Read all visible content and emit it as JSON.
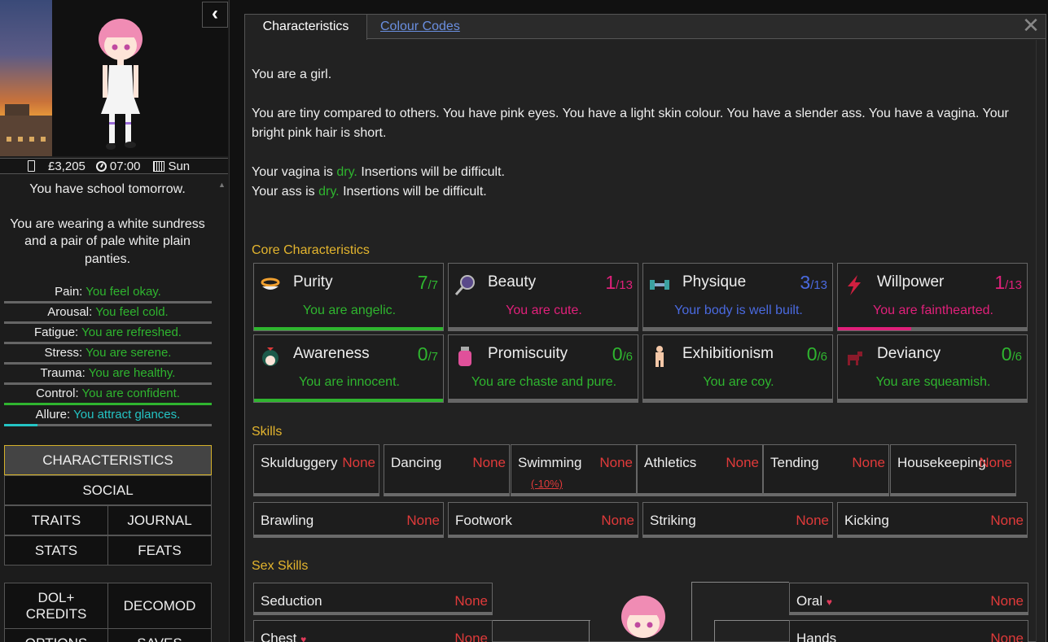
{
  "sidebar": {
    "status": {
      "money": "£3,205",
      "time": "07:00",
      "day": "Sun"
    },
    "school_notice": "You have school tomorrow.",
    "clothing": "You are wearing a white sundress and a pair of pale white plain panties.",
    "stats": [
      {
        "label": "Pain:",
        "value": "You feel okay.",
        "color": "#2fb52f",
        "level": 0
      },
      {
        "label": "Arousal:",
        "value": "You feel cold.",
        "color": "#2fb52f",
        "level": 0
      },
      {
        "label": "Fatigue:",
        "value": "You are refreshed.",
        "color": "#2fb52f",
        "level": 0
      },
      {
        "label": "Stress:",
        "value": "You are serene.",
        "color": "#2fb52f",
        "level": 0
      },
      {
        "label": "Trauma:",
        "value": "You are healthy.",
        "color": "#2fb52f",
        "level": 0
      },
      {
        "label": "Control:",
        "value": "You are confident.",
        "color": "#2fb52f",
        "level": 1
      },
      {
        "label": "Allure:",
        "value": "You attract glances.",
        "color": "#24c4c4",
        "level": 0.16
      }
    ],
    "nav": {
      "characteristics": "CHARACTERISTICS",
      "social": "SOCIAL",
      "traits": "TRAITS",
      "journal": "JOURNAL",
      "stats": "STATS",
      "feats": "FEATS",
      "dol_credits": "DOL+ CREDITS",
      "decomod": "DECOMOD",
      "options": "OPTIONS",
      "saves": "SAVES"
    }
  },
  "tabs": {
    "active": "Characteristics",
    "other": "Colour Codes"
  },
  "description": {
    "line1": "You are a girl.",
    "line2": "You are tiny compared to others. You have pink eyes. You have a light skin colour. You have a slender ass. You have a vagina. Your bright pink hair is short.",
    "vagina_pre": "Your vagina is",
    "vagina_state": "dry.",
    "vagina_post": "Insertions will be difficult.",
    "ass_pre": "Your ass is",
    "ass_state": "dry.",
    "ass_post": "Insertions will be difficult."
  },
  "core": {
    "title": "Core Characteristics",
    "items": [
      {
        "name": "Purity",
        "score": "7",
        "max": "/7",
        "desc": "You are angelic.",
        "color": "#2fb52f",
        "level": 1,
        "icon": "halo-icon"
      },
      {
        "name": "Beauty",
        "score": "1",
        "max": "/13",
        "desc": "You are cute.",
        "color": "#e0207a",
        "level": 0,
        "icon": "mirror-icon"
      },
      {
        "name": "Physique",
        "score": "3",
        "max": "/13",
        "desc": "Your body is well built.",
        "color": "#4a6ae0",
        "level": 0,
        "icon": "dumbbell-icon"
      },
      {
        "name": "Willpower",
        "score": "1",
        "max": "/13",
        "desc": "You are fainthearted.",
        "color": "#e0207a",
        "level": 0.39,
        "icon": "lightning-icon"
      },
      {
        "name": "Awareness",
        "score": "0",
        "max": "/7",
        "desc": "You are innocent.",
        "color": "#2fb52f",
        "level": 1,
        "icon": "awareness-icon"
      },
      {
        "name": "Promiscuity",
        "score": "0",
        "max": "/6",
        "desc": "You are chaste and pure.",
        "color": "#2fb52f",
        "level": 0,
        "icon": "potion-icon"
      },
      {
        "name": "Exhibitionism",
        "score": "0",
        "max": "/6",
        "desc": "You are coy.",
        "color": "#2fb52f",
        "level": 0,
        "icon": "figure-icon"
      },
      {
        "name": "Deviancy",
        "score": "0",
        "max": "/6",
        "desc": "You are squeamish.",
        "color": "#2fb52f",
        "level": 0,
        "icon": "dog-icon"
      }
    ]
  },
  "skills": {
    "title": "Skills",
    "row1": [
      {
        "name": "Skulduggery",
        "value": "None"
      },
      {
        "name": "Dancing",
        "value": "None"
      },
      {
        "name": "Swimming",
        "value": "None",
        "sub": "(-10%)"
      },
      {
        "name": "Athletics",
        "value": "None"
      },
      {
        "name": "Tending",
        "value": "None"
      },
      {
        "name": "Housekeeping",
        "value": "None"
      }
    ],
    "row2": [
      {
        "name": "Brawling",
        "value": "None"
      },
      {
        "name": "Footwork",
        "value": "None"
      },
      {
        "name": "Striking",
        "value": "None"
      },
      {
        "name": "Kicking",
        "value": "None"
      }
    ]
  },
  "sex_skills": {
    "title": "Sex Skills",
    "seduction": {
      "name": "Seduction",
      "value": "None"
    },
    "oral": {
      "name": "Oral",
      "value": "None"
    },
    "chest": {
      "name": "Chest",
      "value": "None"
    },
    "hands": {
      "name": "Hands",
      "value": "None"
    },
    "heart": "♥"
  },
  "colors": {
    "accent_gold": "#e4b52e",
    "none_red": "#e03a3a",
    "link_blue": "#6a8fe0"
  }
}
